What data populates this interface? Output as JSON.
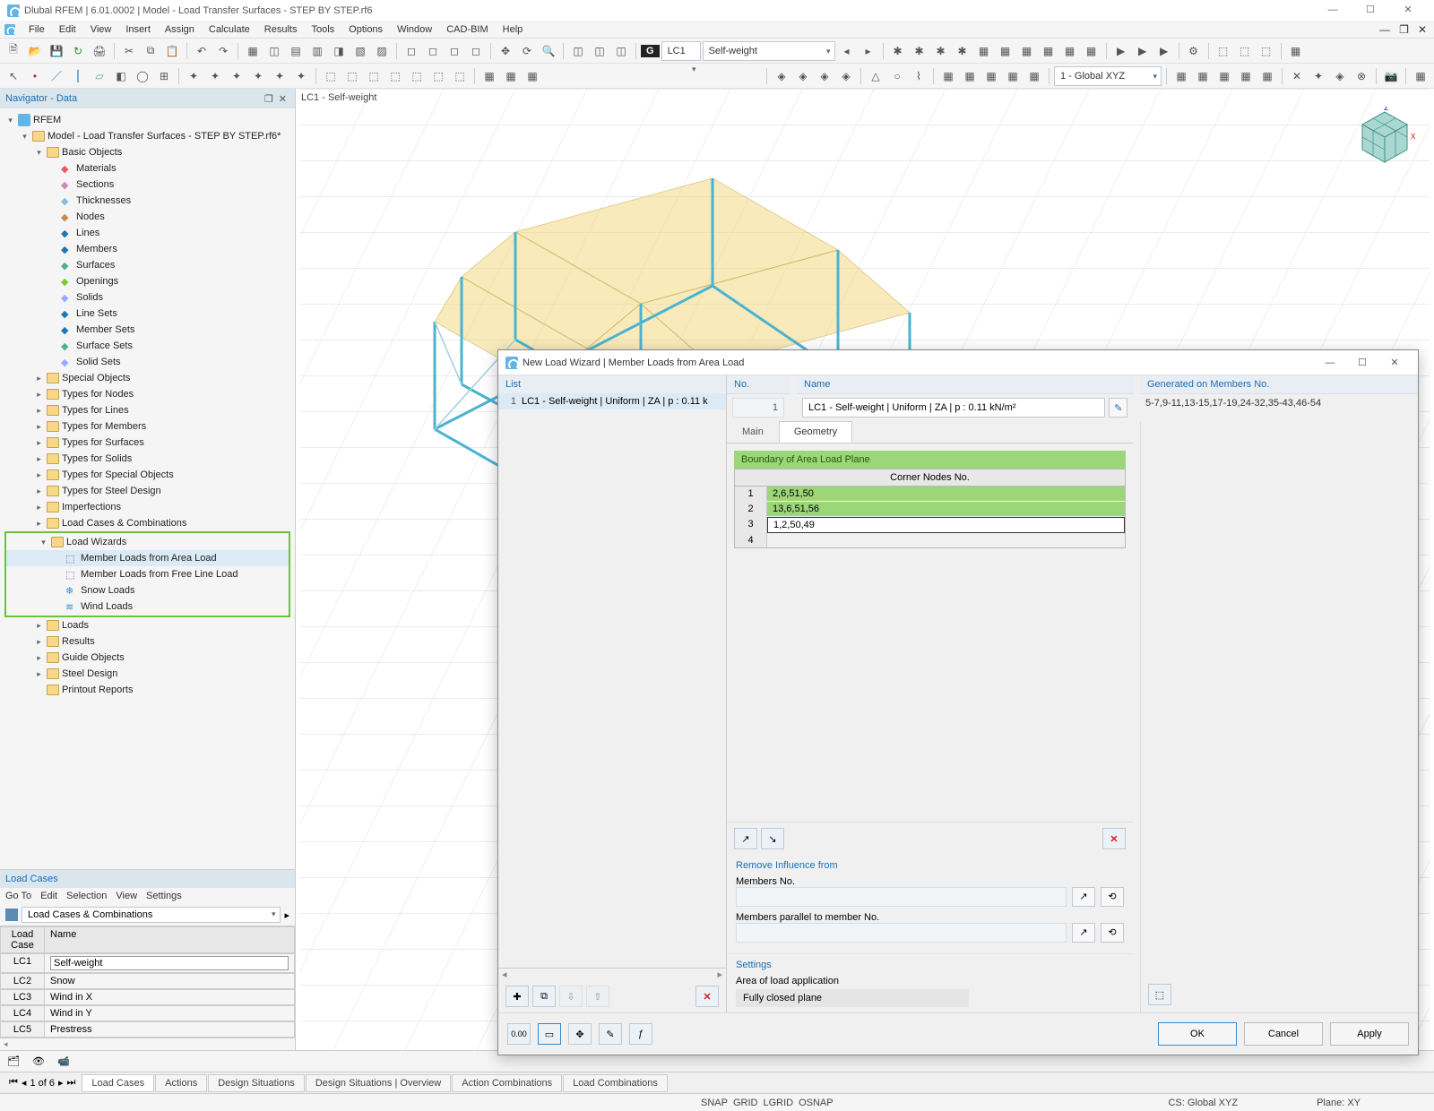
{
  "app": {
    "title": "Dlubal RFEM | 6.01.0002 | Model - Load Transfer Surfaces - STEP BY STEP.rf6"
  },
  "menu": [
    "File",
    "Edit",
    "View",
    "Insert",
    "Assign",
    "Calculate",
    "Results",
    "Tools",
    "Options",
    "Window",
    "CAD-BIM",
    "Help"
  ],
  "toolbar1": {
    "lc_badge": "G",
    "lc_short": "LC1",
    "lc_name": "Self-weight",
    "coord_system": "1 - Global XYZ"
  },
  "navigator": {
    "title": "Navigator - Data",
    "root": "RFEM",
    "model": "Model - Load Transfer Surfaces - STEP BY STEP.rf6*",
    "basic": "Basic Objects",
    "basic_children": [
      "Materials",
      "Sections",
      "Thicknesses",
      "Nodes",
      "Lines",
      "Members",
      "Surfaces",
      "Openings",
      "Solids",
      "Line Sets",
      "Member Sets",
      "Surface Sets",
      "Solid Sets"
    ],
    "folders1": [
      "Special Objects",
      "Types for Nodes",
      "Types for Lines",
      "Types for Members",
      "Types for Surfaces",
      "Types for Solids",
      "Types for Special Objects",
      "Types for Steel Design",
      "Imperfections",
      "Load Cases & Combinations"
    ],
    "load_wizards": "Load Wizards",
    "wizards": [
      "Member Loads from Area Load",
      "Member Loads from Free Line Load",
      "Snow Loads",
      "Wind Loads"
    ],
    "folders2": [
      "Loads",
      "Results",
      "Guide Objects",
      "Steel Design",
      "Printout Reports"
    ]
  },
  "viewport": {
    "label": "LC1 - Self-weight"
  },
  "loadcases": {
    "title": "Load Cases",
    "tabs": [
      "Go To",
      "Edit",
      "Selection",
      "View",
      "Settings"
    ],
    "combo": "Load Cases & Combinations",
    "headers": {
      "a": "Load Case",
      "b": "Name"
    },
    "rows": [
      {
        "id": "LC1",
        "name": "Self-weight"
      },
      {
        "id": "LC2",
        "name": "Snow"
      },
      {
        "id": "LC3",
        "name": "Wind in X"
      },
      {
        "id": "LC4",
        "name": "Wind in Y"
      },
      {
        "id": "LC5",
        "name": "Prestress"
      }
    ],
    "pager": "1 of 6",
    "bottom_tabs": [
      "Load Cases",
      "Actions",
      "Design Situations",
      "Design Situations | Overview",
      "Action Combinations",
      "Load Combinations"
    ]
  },
  "dialog": {
    "title": "New Load Wizard | Member Loads from Area Load",
    "list_head": "List",
    "list_item_num": "1",
    "list_item": "LC1 - Self-weight | Uniform | ZA | p : 0.11 k",
    "no_head": "No.",
    "no_val": "1",
    "name_head": "Name",
    "name_val": "LC1 - Self-weight | Uniform | ZA | p : 0.11 kN/m²",
    "gen_head": "Generated on Members No.",
    "gen_val": "5-7,9-11,13-15,17-19,24-32,35-43,46-54",
    "tabs": [
      "Main",
      "Geometry"
    ],
    "geom_title": "Boundary of Area Load Plane",
    "geom_header": "Corner Nodes No.",
    "geom_rows": [
      "2,6,51,50",
      "13,6,51,56",
      "1,2,50,49",
      ""
    ],
    "remove_title": "Remove Influence from",
    "members_no": "Members No.",
    "members_par": "Members parallel to member No.",
    "settings_title": "Settings",
    "area_label": "Area of load application",
    "area_val": "Fully closed plane",
    "ok": "OK",
    "cancel": "Cancel",
    "apply": "Apply"
  },
  "status": {
    "snap": "SNAP",
    "grid": "GRID",
    "lgrid": "LGRID",
    "osnap": "OSNAP",
    "cs": "CS: Global XYZ",
    "plane": "Plane: XY"
  }
}
